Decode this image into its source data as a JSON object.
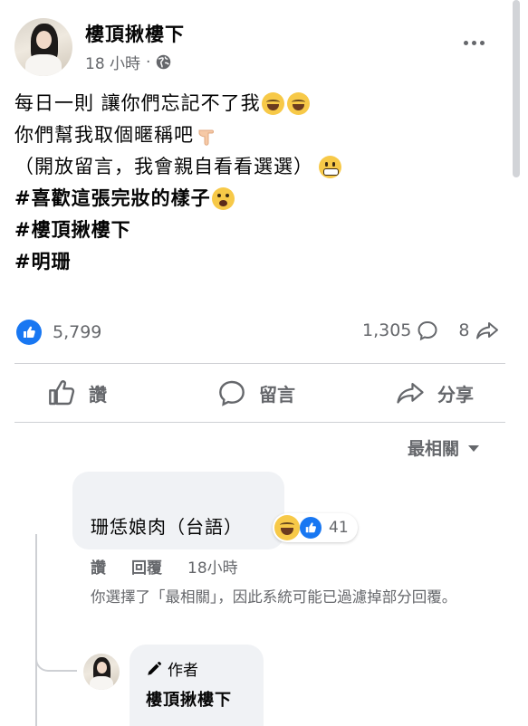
{
  "post": {
    "page_name": "樓頂揪樓下",
    "time": "18 小時",
    "time_separator": "·",
    "privacy_icon": "globe-icon",
    "lines": [
      "每日一則 讓你們忘記不了我",
      "你們幫我取個暱稱吧",
      "（開放留言，我會親自看看選選）",
      "#喜歡這張完妝的樣子",
      "#樓頂揪樓下",
      "#明珊"
    ]
  },
  "stats": {
    "likes": "5,799",
    "comments": "1,305",
    "shares": "8"
  },
  "actions": {
    "like_label": "讚",
    "comment_label": "留言",
    "share_label": "分享"
  },
  "sort": {
    "label": "最相關"
  },
  "comment": {
    "text": "珊恁娘肉（台語）",
    "reaction_count": "41",
    "like_label": "讚",
    "reply_label": "回覆",
    "time": "18小時",
    "note": "你選擇了「最相關」，因此系統可能已過濾掉部分回覆。"
  },
  "reply": {
    "badge": "作者",
    "author": "樓頂揪樓下"
  },
  "colors": {
    "accent": "#1877f2",
    "secondary_text": "#65676b",
    "bubble": "#f0f2f5"
  }
}
